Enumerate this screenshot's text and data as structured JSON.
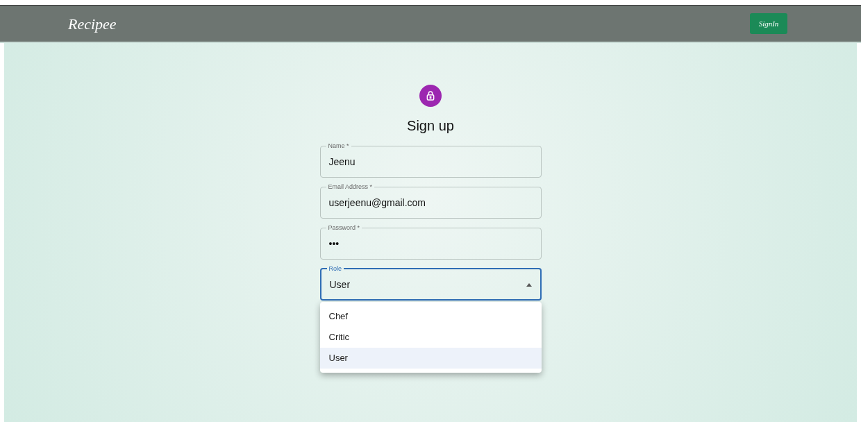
{
  "navbar": {
    "brand": "Recipee",
    "signin_button": "SignIn"
  },
  "form": {
    "title": "Sign up",
    "fields": [
      {
        "label": "Name *",
        "value": "Jeenu",
        "focused": false
      },
      {
        "label": "Email Address *",
        "value": "userjeenu@gmail.com",
        "focused": false
      },
      {
        "label": "Password *",
        "value": "•••",
        "focused": false
      }
    ],
    "role": {
      "label": "Role",
      "value": "User",
      "focused": true,
      "expanded": true,
      "options": [
        {
          "label": "Chef",
          "selected": false
        },
        {
          "label": "Critic",
          "selected": false
        },
        {
          "label": "User",
          "selected": true
        }
      ]
    }
  }
}
